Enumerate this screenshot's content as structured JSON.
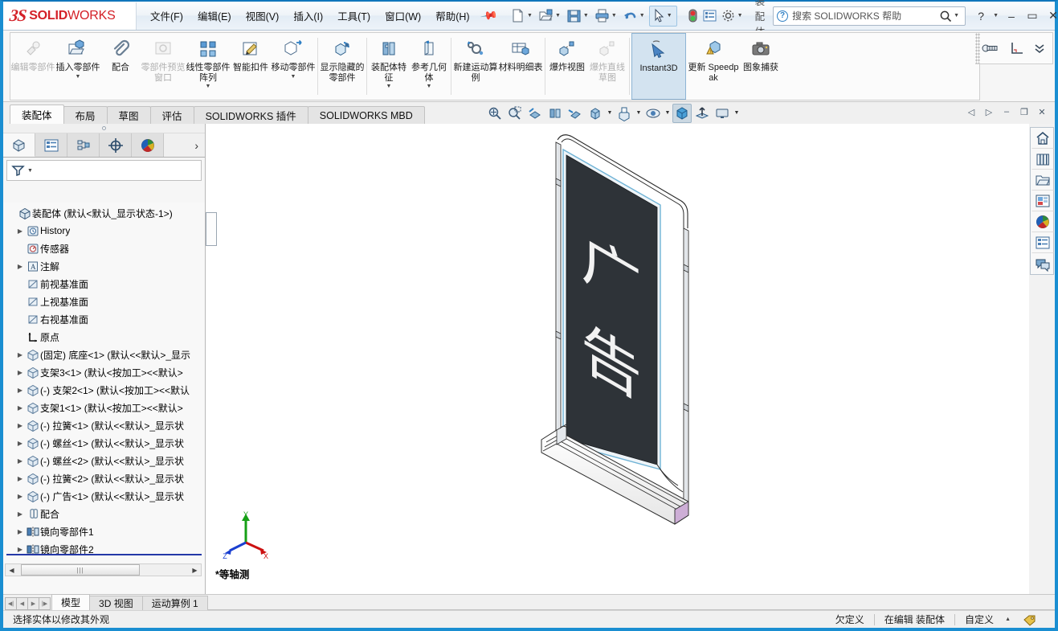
{
  "titlebar": {
    "brand_ds": "2S",
    "brand_solid": "SOLID",
    "brand_works": "WORKS",
    "menus": [
      {
        "label": "文件(F)",
        "name": "menu-file"
      },
      {
        "label": "编辑(E)",
        "name": "menu-edit"
      },
      {
        "label": "视图(V)",
        "name": "menu-view"
      },
      {
        "label": "插入(I)",
        "name": "menu-insert"
      },
      {
        "label": "工具(T)",
        "name": "menu-tools"
      },
      {
        "label": "窗口(W)",
        "name": "menu-window"
      },
      {
        "label": "帮助(H)",
        "name": "menu-help"
      }
    ],
    "pin_icon": "pushpin-icon",
    "quick_access": [
      {
        "name": "new-document-button",
        "icon": "new-document-icon",
        "has_caret": true
      },
      {
        "name": "open-document-button",
        "icon": "open-folder-icon",
        "has_caret": true
      },
      {
        "name": "save-button",
        "icon": "floppy-save-icon",
        "has_caret": true
      },
      {
        "name": "print-button",
        "icon": "printer-icon",
        "has_caret": true
      },
      {
        "name": "undo-button",
        "icon": "undo-arrow-icon",
        "has_caret": true
      },
      {
        "name": "select-button",
        "icon": "cursor-arrow-icon",
        "has_caret": true
      },
      {
        "name": "rebuild-button",
        "icon": "traffic-light-icon",
        "has_caret": false
      },
      {
        "name": "options-display-button",
        "icon": "list-panel-icon",
        "has_caret": false
      },
      {
        "name": "options-button",
        "icon": "gear-icon",
        "has_caret": true
      }
    ],
    "assembly_label": "装配体",
    "search_placeholder": "搜索 SOLIDWORKS 帮助",
    "search_value": "",
    "help_button": "?",
    "minimize": "–",
    "maximize": "▭",
    "close": "✕"
  },
  "ribbon": {
    "items": [
      {
        "label": "编辑零部件",
        "name": "ribbon-edit-component",
        "icon": "edit-component-icon",
        "dimmed": true,
        "caret": false,
        "active": false
      },
      {
        "label": "插入零部件",
        "name": "ribbon-insert-component",
        "icon": "insert-component-icon",
        "dimmed": false,
        "caret": true,
        "active": false
      },
      {
        "label": "配合",
        "name": "ribbon-mate",
        "icon": "paperclip-mate-icon",
        "dimmed": false,
        "caret": false,
        "active": false
      },
      {
        "label": "零部件预览窗口",
        "name": "ribbon-component-preview",
        "icon": "preview-window-icon",
        "dimmed": true,
        "caret": false,
        "active": false
      },
      {
        "label": "线性零部件阵列",
        "name": "ribbon-linear-component-pattern",
        "icon": "linear-pattern-icon",
        "dimmed": false,
        "caret": true,
        "active": false
      },
      {
        "label": "智能扣件",
        "name": "ribbon-smart-fasteners",
        "icon": "smart-fastener-icon",
        "dimmed": false,
        "caret": false,
        "active": false
      },
      {
        "label": "移动零部件",
        "name": "ribbon-move-component",
        "icon": "move-component-icon",
        "dimmed": false,
        "caret": true,
        "active": false
      },
      {
        "label": "显示隐藏的零部件",
        "name": "ribbon-show-hidden-components",
        "icon": "show-hidden-icon",
        "dimmed": false,
        "caret": false,
        "active": false
      },
      {
        "label": "装配体特征",
        "name": "ribbon-assembly-features",
        "icon": "assembly-feature-icon",
        "dimmed": false,
        "caret": true,
        "active": false
      },
      {
        "label": "参考几何体",
        "name": "ribbon-reference-geometry",
        "icon": "reference-geometry-icon",
        "dimmed": false,
        "caret": true,
        "active": false
      },
      {
        "label": "新建运动算例",
        "name": "ribbon-new-motion-study",
        "icon": "new-motion-study-icon",
        "dimmed": false,
        "caret": false,
        "active": false
      },
      {
        "label": "材料明细表",
        "name": "ribbon-bill-of-materials",
        "icon": "bom-table-icon",
        "dimmed": false,
        "caret": false,
        "active": false
      },
      {
        "label": "爆炸视图",
        "name": "ribbon-exploded-view",
        "icon": "exploded-view-icon",
        "dimmed": false,
        "caret": false,
        "active": false
      },
      {
        "label": "爆炸直线草图",
        "name": "ribbon-explode-line-sketch",
        "icon": "explode-line-icon",
        "dimmed": true,
        "caret": false,
        "active": false
      },
      {
        "label": "Instant3D",
        "name": "ribbon-instant3d",
        "icon": "instant3d-arrow-icon",
        "dimmed": false,
        "caret": false,
        "active": true
      },
      {
        "label": "更新 Speedpak",
        "name": "ribbon-update-speedpak",
        "icon": "update-speedpak-icon",
        "dimmed": false,
        "caret": false,
        "active": false
      },
      {
        "label": "图象捕获",
        "name": "ribbon-capture-image",
        "icon": "camera-icon",
        "dimmed": false,
        "caret": false,
        "active": false
      }
    ],
    "right_icons": [
      {
        "name": "fastener-icon"
      },
      {
        "name": "corner-angle-icon"
      },
      {
        "name": "chevron-double-down-icon"
      }
    ]
  },
  "tabs": {
    "items": [
      {
        "label": "装配体",
        "name": "tab-assembly",
        "selected": true
      },
      {
        "label": "布局",
        "name": "tab-layout",
        "selected": false
      },
      {
        "label": "草图",
        "name": "tab-sketch",
        "selected": false
      },
      {
        "label": "评估",
        "name": "tab-evaluate",
        "selected": false
      },
      {
        "label": "SOLIDWORKS 插件",
        "name": "tab-solidworks-addins",
        "selected": false
      },
      {
        "label": "SOLIDWORKS MBD",
        "name": "tab-solidworks-mbd",
        "selected": false
      }
    ]
  },
  "view_toolbar": {
    "buttons": [
      {
        "name": "zoom-to-fit-icon",
        "caret": false,
        "on": false
      },
      {
        "name": "zoom-to-area-icon",
        "caret": false,
        "on": false
      },
      {
        "name": "section-view-icon",
        "caret": false,
        "on": false
      },
      {
        "name": "view-orientation-icon",
        "caret": false,
        "on": false
      },
      {
        "name": "previous-view-icon",
        "caret": false,
        "on": false
      },
      {
        "name": "display-style-icon",
        "caret": true,
        "on": false
      },
      {
        "name": "hide-show-items-icon",
        "caret": true,
        "on": false
      },
      {
        "name": "view-settings-icon",
        "caret": true,
        "on": false
      },
      {
        "name": "apply-scene-icon",
        "caret": false,
        "on": true
      },
      {
        "name": "view-orientation-axis-icon",
        "caret": false,
        "on": false
      },
      {
        "name": "display-monitor-icon",
        "caret": true,
        "on": false
      }
    ],
    "window_controls": [
      {
        "name": "previous-pane-icon",
        "glyph": "◁"
      },
      {
        "name": "next-pane-icon",
        "glyph": "▷"
      },
      {
        "name": "minimize-document-icon",
        "glyph": "–"
      },
      {
        "name": "restore-document-icon",
        "glyph": "❐"
      },
      {
        "name": "close-document-icon",
        "glyph": "✕"
      }
    ]
  },
  "left_panel": {
    "tabs": [
      {
        "name": "panel-tab-feature-manager",
        "icon": "feature-tree-icon",
        "selected": true
      },
      {
        "name": "panel-tab-property-manager",
        "icon": "property-manager-icon",
        "selected": false
      },
      {
        "name": "panel-tab-configuration-manager",
        "icon": "configuration-manager-icon",
        "selected": false
      },
      {
        "name": "panel-tab-dimxpert-manager",
        "icon": "dimxpert-icon",
        "selected": false
      },
      {
        "name": "panel-tab-display-manager",
        "icon": "display-manager-color-icon",
        "selected": false
      }
    ],
    "more_glyph": "›",
    "filter_icon": "filter-funnel-icon",
    "filter_value": "",
    "tree": [
      {
        "label": "装配体  (默认<默认_显示状态-1>)",
        "icon": "assembly-icon",
        "indent": 0,
        "expandable": false,
        "name": "tree-root-assembly"
      },
      {
        "label": "History",
        "icon": "history-icon",
        "indent": 1,
        "expandable": true,
        "name": "tree-item-history"
      },
      {
        "label": "传感器",
        "icon": "sensor-icon",
        "indent": 1,
        "expandable": false,
        "name": "tree-item-sensors"
      },
      {
        "label": "注解",
        "icon": "annotations-icon",
        "indent": 1,
        "expandable": true,
        "name": "tree-item-annotations"
      },
      {
        "label": "前视基准面",
        "icon": "plane-icon",
        "indent": 1,
        "expandable": false,
        "name": "tree-item-front-plane"
      },
      {
        "label": "上视基准面",
        "icon": "plane-icon",
        "indent": 1,
        "expandable": false,
        "name": "tree-item-top-plane"
      },
      {
        "label": "右视基准面",
        "icon": "plane-icon",
        "indent": 1,
        "expandable": false,
        "name": "tree-item-right-plane"
      },
      {
        "label": "原点",
        "icon": "origin-icon",
        "indent": 1,
        "expandable": false,
        "name": "tree-item-origin"
      },
      {
        "label": "(固定) 底座<1>  (默认<<默认>_显示",
        "icon": "component-icon",
        "indent": 1,
        "expandable": true,
        "name": "tree-item-base"
      },
      {
        "label": "支架3<1>  (默认<按加工><<默认>",
        "icon": "component-icon",
        "indent": 1,
        "expandable": true,
        "name": "tree-item-bracket3"
      },
      {
        "label": "(-) 支架2<1>  (默认<按加工><<默认",
        "icon": "component-icon",
        "indent": 1,
        "expandable": true,
        "name": "tree-item-bracket2"
      },
      {
        "label": "支架1<1>  (默认<按加工><<默认>",
        "icon": "component-icon",
        "indent": 1,
        "expandable": true,
        "name": "tree-item-bracket1"
      },
      {
        "label": "(-) 拉簧<1>  (默认<<默认>_显示状",
        "icon": "component-icon",
        "indent": 1,
        "expandable": true,
        "name": "tree-item-spring1"
      },
      {
        "label": "(-) 螺丝<1>  (默认<<默认>_显示状",
        "icon": "component-icon",
        "indent": 1,
        "expandable": true,
        "name": "tree-item-screw1"
      },
      {
        "label": "(-) 螺丝<2>  (默认<<默认>_显示状",
        "icon": "component-icon",
        "indent": 1,
        "expandable": true,
        "name": "tree-item-screw2"
      },
      {
        "label": "(-) 拉簧<2>  (默认<<默认>_显示状",
        "icon": "component-icon",
        "indent": 1,
        "expandable": true,
        "name": "tree-item-spring2"
      },
      {
        "label": "(-) 广告<1>  (默认<<默认>_显示状",
        "icon": "component-icon",
        "indent": 1,
        "expandable": true,
        "name": "tree-item-advertisement"
      },
      {
        "label": "配合",
        "icon": "mates-folder-icon",
        "indent": 1,
        "expandable": true,
        "name": "tree-item-mates"
      },
      {
        "label": "镜向零部件1",
        "icon": "mirror-component-icon",
        "indent": 1,
        "expandable": true,
        "name": "tree-item-mirror1"
      },
      {
        "label": "镜向零部件2",
        "icon": "mirror-component-icon",
        "indent": 1,
        "expandable": true,
        "name": "tree-item-mirror2"
      }
    ],
    "hscroll_grip": "|||"
  },
  "graphics": {
    "view_label": "*等轴测",
    "triad": {
      "x": "X",
      "y": "Y",
      "z": "Z"
    },
    "model": {
      "name": "roll-up-banner-stand",
      "banner_text_line1": "广",
      "banner_text_line2": "告",
      "banner_color": "#2e3338",
      "frame_color": "#ffffff",
      "base_accent": "#c9aed1"
    }
  },
  "right_bar": {
    "buttons": [
      {
        "name": "home-icon"
      },
      {
        "name": "design-library-books-icon"
      },
      {
        "name": "file-explorer-folder-icon"
      },
      {
        "name": "view-palette-icon"
      },
      {
        "name": "appearances-scenes-color-icon"
      },
      {
        "name": "custom-properties-icon"
      },
      {
        "name": "comments-bubble-icon"
      }
    ]
  },
  "bottom": {
    "nav_arrows": [
      "◀|",
      "◀",
      "▶",
      "|▶"
    ],
    "tabs": [
      {
        "label": "模型",
        "name": "bottom-tab-model",
        "selected": true
      },
      {
        "label": "3D 视图",
        "name": "bottom-tab-3d-views",
        "selected": false
      },
      {
        "label": "运动算例 1",
        "name": "bottom-tab-motion-study-1",
        "selected": false
      }
    ]
  },
  "status": {
    "message": "选择实体以修改其外观",
    "underdefined": "欠定义",
    "editing": "在编辑 装配体",
    "custom": "自定义",
    "custom_caret": "▲",
    "tag_icon": "tag-icon"
  }
}
